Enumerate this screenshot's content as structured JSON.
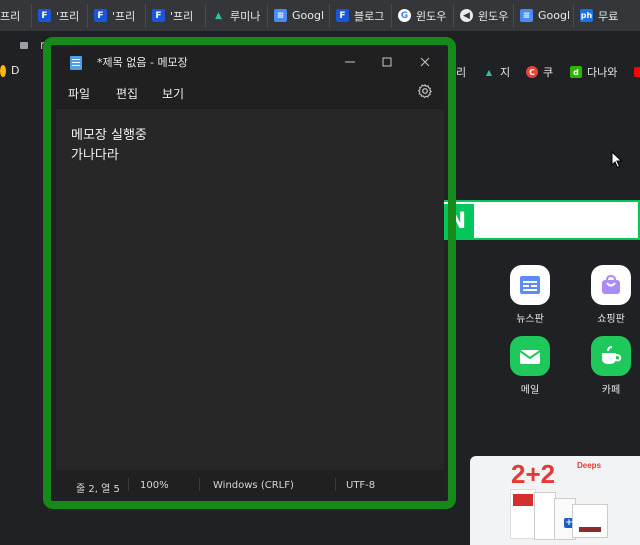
{
  "browser": {
    "tabs": [
      {
        "title": "프리",
        "icon": "partial-icon"
      },
      {
        "title": "'프리",
        "icon": "f-icon"
      },
      {
        "title": "'프리",
        "icon": "f-icon"
      },
      {
        "title": "'프리",
        "icon": "f-icon"
      },
      {
        "title": "루미나",
        "icon": "graduation-cap-icon"
      },
      {
        "title": "Googl",
        "icon": "google-docs-icon"
      },
      {
        "title": "블로그",
        "icon": "f-icon"
      },
      {
        "title": "윈도우",
        "icon": "google-icon"
      },
      {
        "title": "윈도우",
        "icon": "hex-icon"
      },
      {
        "title": "Googl",
        "icon": "google-docs-icon"
      },
      {
        "title": "무료",
        "icon": "ph-icon"
      }
    ],
    "address_letter": "n",
    "bookmarks": {
      "left_label": "D",
      "right": [
        {
          "label": "리",
          "icon": "partial-icon"
        },
        {
          "label": "지",
          "icon": "graduation-cap-icon"
        },
        {
          "label": "쿠",
          "icon": "c-icon"
        },
        {
          "label": "다나와",
          "icon": "d-icon"
        }
      ]
    },
    "naver_logo": "N",
    "shortcuts": [
      {
        "label": "뉴스판",
        "icon": "news-icon"
      },
      {
        "label": "쇼핑판",
        "icon": "shopping-bag-icon"
      },
      {
        "label": "메일",
        "icon": "mail-icon"
      },
      {
        "label": "카페",
        "icon": "cafe-icon"
      }
    ],
    "ad": {
      "headline": "2+2",
      "brand": "Deeps"
    }
  },
  "notepad": {
    "title": "*제목 없음 - 메모장",
    "menu": [
      "파일",
      "편집",
      "보기"
    ],
    "text_lines": [
      "메모장 실행중",
      "가나다라"
    ],
    "status": {
      "position": "줄 2, 열 5",
      "zoom": "100%",
      "line_ending": "Windows (CRLF)",
      "encoding": "UTF-8"
    }
  },
  "colors": {
    "highlight": "#16891b",
    "naver_green": "#03c75a",
    "notepad_bg": "#202020",
    "editor_bg": "#272727"
  }
}
